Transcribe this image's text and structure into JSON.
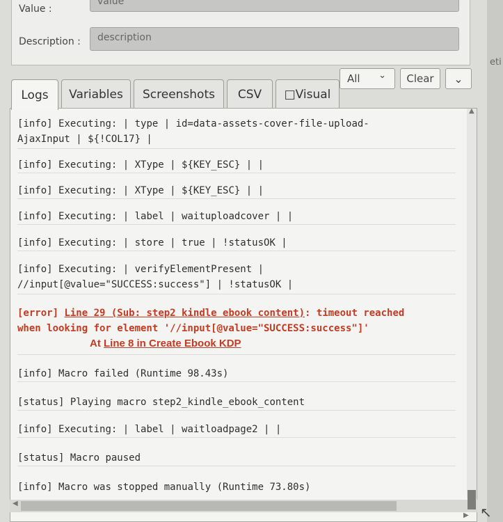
{
  "form": {
    "value_label": "Value :",
    "value_field": "value",
    "description_label": "Description :",
    "description_field": "description"
  },
  "side_text": "eti",
  "tabs": [
    {
      "label": "Logs"
    },
    {
      "label": "Variables"
    },
    {
      "label": "Screenshots"
    },
    {
      "label": "CSV"
    },
    {
      "label": "□Visual"
    }
  ],
  "controls": {
    "filter_value": "All",
    "clear_label": "Clear",
    "chevron_down": "⌄"
  },
  "logs": [
    {
      "prefix": "[info]",
      "text": "Executing:  | type | id=data-assets-cover-file-upload-",
      "text2": "AjaxInput | ${!COL17} |"
    },
    {
      "prefix": "[info]",
      "text": "Executing:  | XType | ${KEY_ESC} |  |"
    },
    {
      "prefix": "[info]",
      "text": "Executing:  | XType | ${KEY_ESC} |  |"
    },
    {
      "prefix": "[info]",
      "text": "Executing:  | label | waituploadcover |  |"
    },
    {
      "prefix": "[info]",
      "text": "Executing:  | store | true | !statusOK |"
    },
    {
      "prefix": "[info]",
      "text": "Executing:  | verifyElementPresent |",
      "text2": "//input[@value=\"SUCCESS:success\"] | !statusOK |"
    },
    {
      "prefix": "[error]",
      "link": "Line 29 (Sub: step2 kindle ebook content)",
      "text": ": timeout reached",
      "text2": "when looking for element '//input[@value=\"SUCCESS:success\"]'",
      "at_prefix": "At ",
      "at_link": "Line 8 in Create Ebook KDP"
    },
    {
      "prefix": "[info]",
      "text": "Macro failed (Runtime 98.43s)"
    },
    {
      "prefix": "[status]",
      "text": "Playing macro step2_kindle_ebook_content"
    },
    {
      "prefix": "[info]",
      "text": "Executing:  | label | waitloadpage2 |  |"
    },
    {
      "prefix": "[status]",
      "text": "Macro paused"
    },
    {
      "prefix": "[info]",
      "text": "Macro was stopped manually (Runtime 73.80s)"
    }
  ]
}
